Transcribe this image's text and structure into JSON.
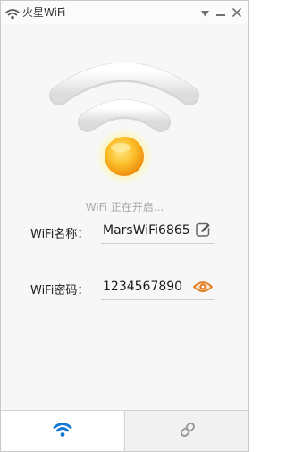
{
  "window": {
    "title": "火星WiFi",
    "controls": [
      "dropdown",
      "minimize",
      "close"
    ]
  },
  "status": {
    "text": "WiFi 正在开启..."
  },
  "wifi_name": {
    "label": "WiFi名称：",
    "value": "MarsWiFi6865",
    "action_icon": "edit-icon"
  },
  "wifi_password": {
    "label": "WiFi密码：",
    "value": "1234567890",
    "action_icon": "eye-icon"
  },
  "tabs": [
    {
      "icon": "wifi-icon",
      "active": true
    },
    {
      "icon": "link-icon",
      "active": false
    }
  ],
  "colors": {
    "accent_blue": "#1478d4",
    "sun_orange": "#f6a21a",
    "eye_orange": "#e07a1f",
    "status_gray": "#a8a8a8"
  }
}
